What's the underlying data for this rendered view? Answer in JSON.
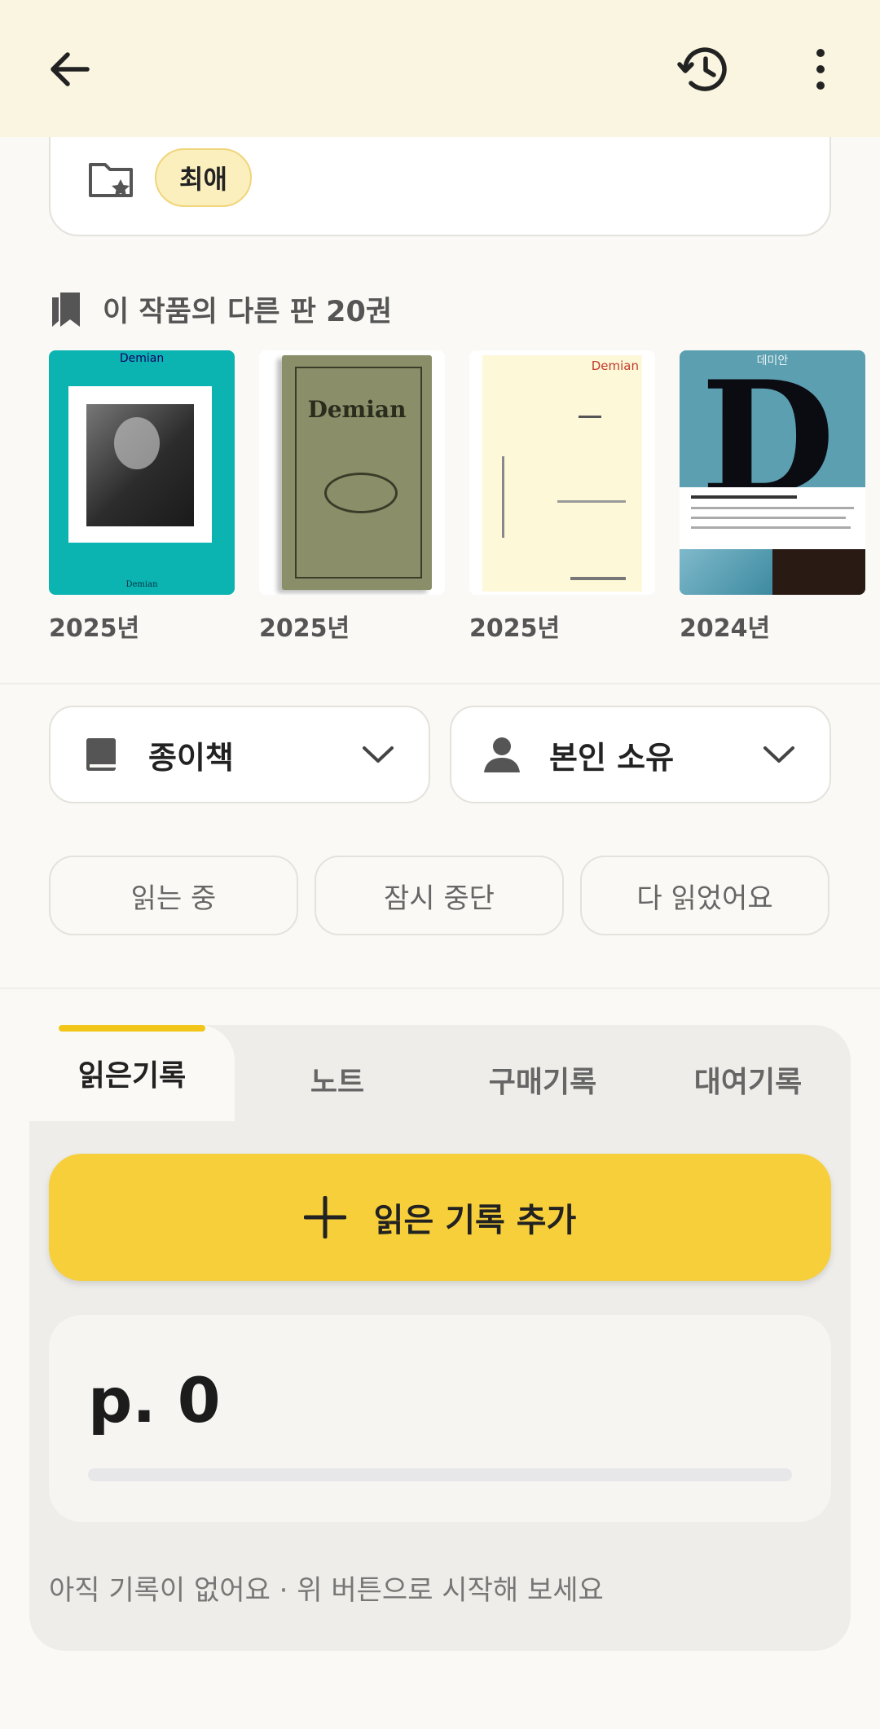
{
  "header": {
    "back_icon": "arrow-left-icon",
    "history_icon": "history-icon",
    "more_icon": "more-vertical-icon"
  },
  "shelf": {
    "folder_icon": "folder-star-icon",
    "chip": "최애"
  },
  "editions": {
    "title": "이 작품의 다른 판 20권",
    "items": [
      {
        "year": "2025년",
        "cover_text": "Demian"
      },
      {
        "year": "2025년",
        "cover_text": "Demian"
      },
      {
        "year": "2025년",
        "cover_text": "Demian"
      },
      {
        "year": "2024년",
        "cover_text": "데미안"
      }
    ]
  },
  "selects": {
    "format": "종이책",
    "ownership": "본인 소유"
  },
  "status": [
    "읽는 중",
    "잠시 중단",
    "다 읽었어요"
  ],
  "tabs": [
    "읽은기록",
    "노트",
    "구매기록",
    "대여기록"
  ],
  "active_tab": 0,
  "add_record": "읽은 기록 추가",
  "progress": {
    "page_label": "p. 0",
    "fraction": 0
  },
  "empty_message": "아직 기록이 없어요 · 위 버튼으로 시작해 보세요",
  "colors": {
    "accent": "#f7cf3a",
    "header_bg": "#f9f5e0",
    "cover_teal": "#0bb3b1",
    "cover_olive": "#8a8f6a",
    "cover_cream": "#fdf8d8",
    "cover_blue": "#5b9fb1"
  }
}
